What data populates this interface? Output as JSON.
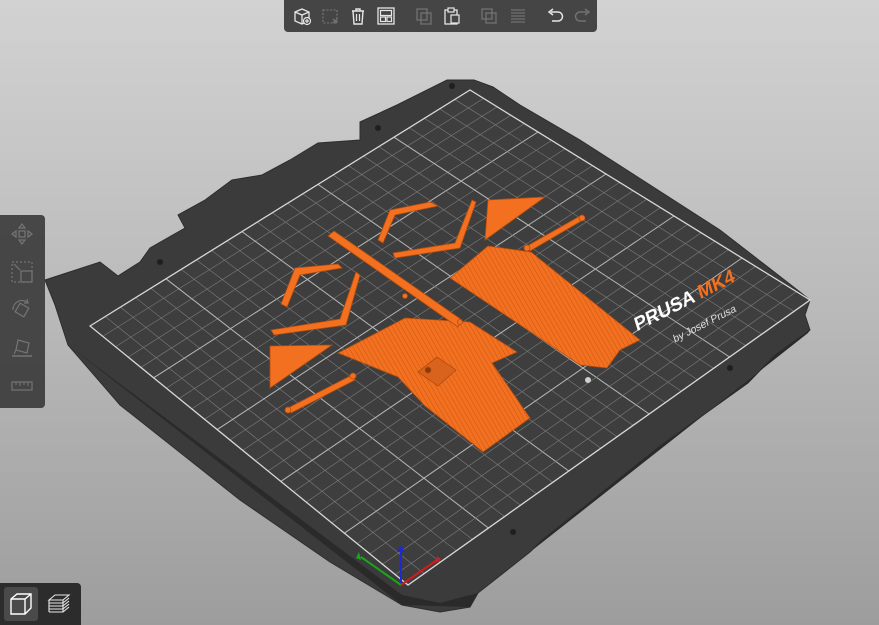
{
  "bed": {
    "brand": "PRUSA",
    "model": "MK4",
    "byline": "by Josef Prusa"
  },
  "toolbar": {
    "items": [
      {
        "name": "add-icon",
        "enabled": true
      },
      {
        "name": "delete-icon",
        "enabled": false
      },
      {
        "name": "delete-all-icon",
        "enabled": true
      },
      {
        "name": "arrange-icon",
        "enabled": true
      },
      {
        "name": "copy-icon",
        "enabled": false
      },
      {
        "name": "paste-icon",
        "enabled": true
      },
      {
        "name": "add-instance-icon",
        "enabled": false
      },
      {
        "name": "split-layers-icon",
        "enabled": false
      },
      {
        "name": "undo-icon",
        "enabled": true
      },
      {
        "name": "redo-icon",
        "enabled": false
      }
    ]
  },
  "left_tools": [
    "move-icon",
    "scale-icon",
    "rotate-icon",
    "place-on-face-icon",
    "measure-icon"
  ],
  "view_modes": [
    {
      "name": "3d-view-icon",
      "active": true
    },
    {
      "name": "preview-layers-icon",
      "active": false
    }
  ],
  "colors": {
    "background": "#bcbcbc",
    "bed": "#3a3a3a",
    "grid": "#8a8a8a",
    "model": "#f37021",
    "ui_panel": "#3a3a3a",
    "icon_enabled": "#e8e8e8",
    "icon_disabled": "#6a6a6a"
  }
}
